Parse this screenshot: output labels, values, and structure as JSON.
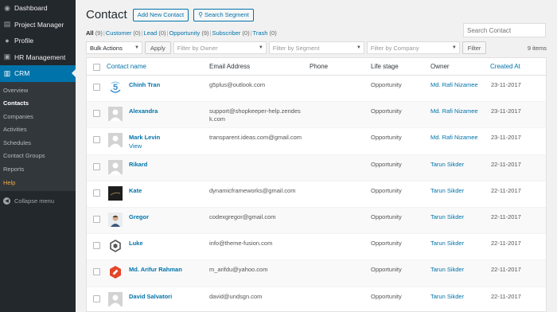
{
  "sidebar": {
    "items": [
      {
        "label": "Dashboard",
        "icon": "dashboard-icon",
        "glyph": "◉"
      },
      {
        "label": "Project Manager",
        "icon": "briefcase-icon",
        "glyph": "▤"
      },
      {
        "label": "Profile",
        "icon": "user-icon",
        "glyph": "●"
      },
      {
        "label": "HR Management",
        "icon": "people-icon",
        "glyph": "▣"
      },
      {
        "label": "CRM",
        "icon": "chart-icon",
        "glyph": "▥"
      }
    ],
    "submenu": [
      "Overview",
      "Contacts",
      "Companies",
      "Activities",
      "Schedules",
      "Contact Groups",
      "Reports",
      "Help"
    ],
    "collapse_label": "Collapse menu"
  },
  "header": {
    "title": "Contact",
    "add_button": "Add New Contact",
    "search_segment_button": "Search Segment",
    "search_placeholder": "Search Contact"
  },
  "filters": [
    {
      "label": "All",
      "count": "(9)"
    },
    {
      "label": "Customer",
      "count": "(0)"
    },
    {
      "label": "Lead",
      "count": "(0)"
    },
    {
      "label": "Opportunity",
      "count": "(9)"
    },
    {
      "label": "Subscriber",
      "count": "(0)"
    },
    {
      "label": "Trash",
      "count": "(0)"
    }
  ],
  "toolbar": {
    "bulk_actions": "Bulk Actions",
    "apply": "Apply",
    "filter_owner": "Filter by Owner",
    "filter_segment": "Filter by Segment",
    "filter_company": "Filter by Company",
    "filter_button": "Filter",
    "items_count": "9 items"
  },
  "table": {
    "columns": [
      "Contact name",
      "Email Address",
      "Phone",
      "Life stage",
      "Owner",
      "Created At"
    ],
    "row_action": "View",
    "rows": [
      {
        "name": "Chinh Tran",
        "email": "g5plus@outlook.com",
        "phone": "",
        "stage": "Opportunity",
        "owner": "Md. Rafi Nizamee",
        "created": "23-11-2017",
        "avatar": "g5-logo"
      },
      {
        "name": "Alexandra",
        "email": "support@shopkeeper-help.zendesk.com",
        "phone": "",
        "stage": "Opportunity",
        "owner": "Md. Rafi Nizamee",
        "created": "23-11-2017",
        "avatar": "default"
      },
      {
        "name": "Mark Levin",
        "email": "transparent.ideas.com@gmail.com",
        "phone": "",
        "stage": "Opportunity",
        "owner": "Md. Rafi Nizamee",
        "created": "23-11-2017",
        "avatar": "default"
      },
      {
        "name": "Rikard",
        "email": "",
        "phone": "",
        "stage": "Opportunity",
        "owner": "Tarun Sikder",
        "created": "22-11-2017",
        "avatar": "default"
      },
      {
        "name": "Kate",
        "email": "dynamicframeworks@gmail.com",
        "phone": "",
        "stage": "Opportunity",
        "owner": "Tarun Sikder",
        "created": "22-11-2017",
        "avatar": "dark-photo"
      },
      {
        "name": "Gregor",
        "email": "codexgregor@gmail.com",
        "phone": "",
        "stage": "Opportunity",
        "owner": "Tarun Sikder",
        "created": "22-11-2017",
        "avatar": "person-photo"
      },
      {
        "name": "Luke",
        "email": "info@theme-fusion.com",
        "phone": "",
        "stage": "Opportunity",
        "owner": "Tarun Sikder",
        "created": "22-11-2017",
        "avatar": "fusion-logo"
      },
      {
        "name": "Md. Arifur Rahman",
        "email": "m_arifdu@yahoo.com",
        "phone": "",
        "stage": "Opportunity",
        "owner": "Tarun Sikder",
        "created": "22-11-2017",
        "avatar": "red-logo"
      },
      {
        "name": "David Salvatori",
        "email": "david@undsgn.com",
        "phone": "",
        "stage": "Opportunity",
        "owner": "Tarun Sikder",
        "created": "22-11-2017",
        "avatar": "default"
      }
    ]
  },
  "colors": {
    "accent": "#0073aa",
    "sidebar": "#23282d",
    "help": "#f0a840"
  }
}
